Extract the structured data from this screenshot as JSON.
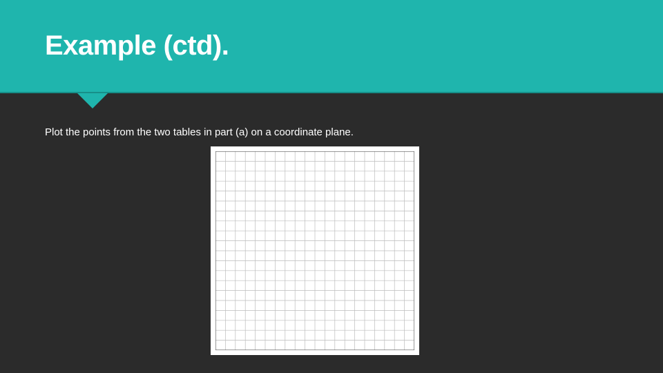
{
  "slide": {
    "title": "Example (ctd).",
    "body_text": "Plot the points from the two tables in part (a) on a coordinate plane.",
    "grid_caption": ""
  },
  "chart_data": {
    "type": "scatter",
    "title": "",
    "xlabel": "",
    "ylabel": "",
    "xlim": [
      0,
      20
    ],
    "ylim": [
      0,
      20
    ],
    "grid": true,
    "series": []
  },
  "colors": {
    "accent": "#1fb5ad",
    "background": "#2b2b2b",
    "text": "#ffffff"
  }
}
